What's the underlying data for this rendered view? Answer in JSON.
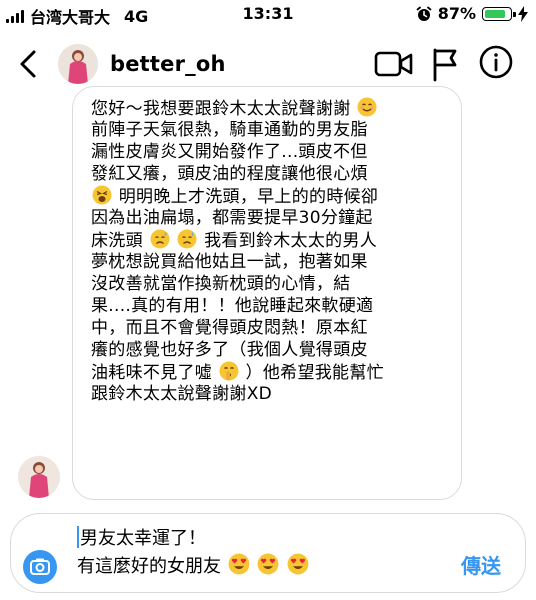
{
  "status_bar": {
    "carrier": "台湾大哥大",
    "network": "4G",
    "time": "13:31",
    "battery_percent_label": "87%",
    "battery_level": 0.87,
    "battery_color": "#34c759"
  },
  "header": {
    "username": "better_oh",
    "icons": [
      "back-chevron-icon",
      "video-call-icon",
      "flag-icon",
      "info-icon"
    ]
  },
  "message": {
    "lines": [
      "您好～我想要跟鈴木太太說聲謝謝",
      "前陣子天氣很熱，騎車通勤的男友脂",
      "漏性皮膚炎又開始發作了...頭皮不但",
      "發紅又癢，頭皮油的程度讓他很心煩",
      "明明晚上才洗頭，早上的的時候卻",
      "因為出油扁塌，都需要提早30分鐘起",
      "床洗頭",
      "我看到鈴木太太的男人",
      "夢枕想說買給他姑且一試，抱著如果",
      "沒改善就當作換新枕頭的心情，結",
      "果....真的有用！！他說睡起來軟硬適",
      "中，而且不會覺得頭皮悶熱！原本紅",
      "癢的感覺也好多了（我個人覺得頭皮",
      "油耗味不見了噓",
      "）他希望我能幫忙",
      "跟鈴木太太說聲謝謝XD"
    ]
  },
  "composer": {
    "line1": "男友太幸運了！",
    "line2": "有這麼好的女朋友",
    "send_label": "傳送"
  },
  "colors": {
    "accent": "#3797f0",
    "bubble_border": "#dbdbdb"
  }
}
